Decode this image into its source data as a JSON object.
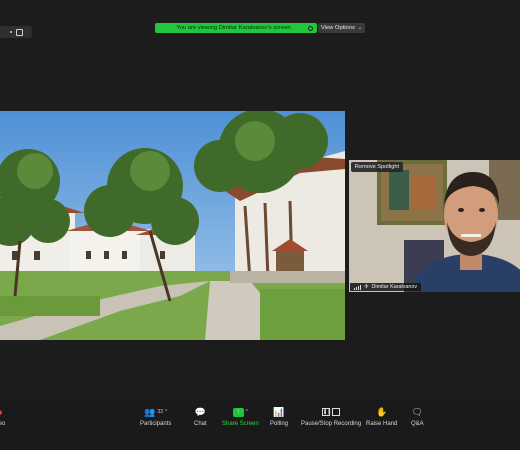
{
  "banner": {
    "text": "You are viewing Dimitar Karalvanov's screen",
    "view_options": "View Options"
  },
  "spotlight": {
    "remove_label": "Remove Spotlight",
    "speaker_name": "Dimitar Karalvanov"
  },
  "toolbar": {
    "video_label": "ideo",
    "participants_label": "Participants",
    "participants_count": "33",
    "chat_label": "Chat",
    "share_label": "Share Screen",
    "polling_label": "Polling",
    "record_label": "Pause/Stop Recording",
    "raise_hand_label": "Raise Hand",
    "qa_label": "Q&A"
  },
  "colors": {
    "accent_green": "#21c63a",
    "background": "#1c1c1c"
  }
}
